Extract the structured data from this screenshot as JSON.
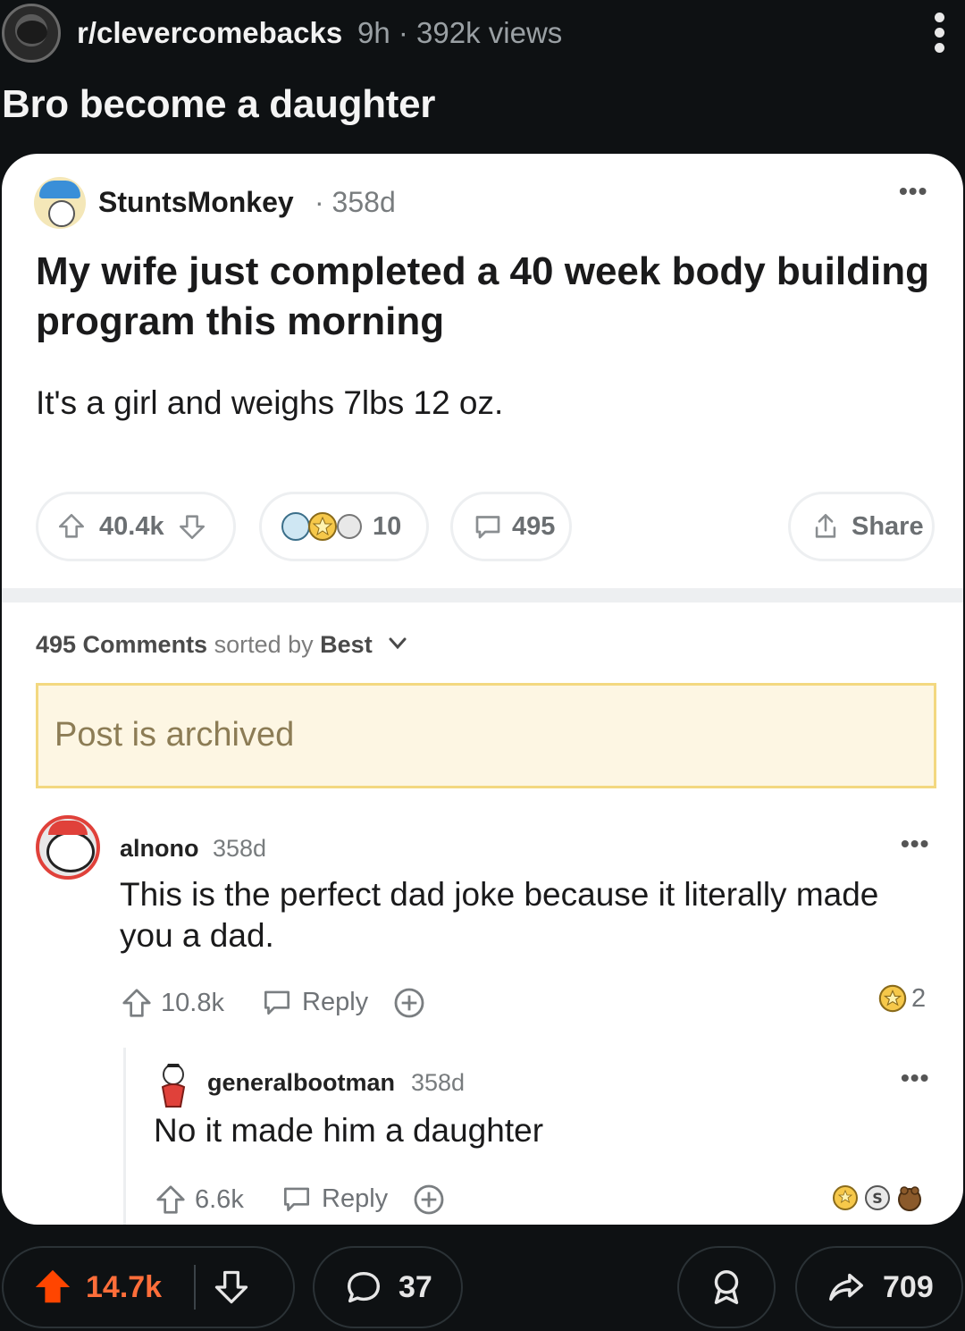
{
  "header": {
    "subreddit": "r/clevercomebacks",
    "meta": "9h · 392k views",
    "title": "Bro become a daughter"
  },
  "post": {
    "author": "StuntsMonkey",
    "time": "· 358d",
    "title": "My wife just completed a 40 week body building program this morning",
    "body": "It's a girl and weighs 7lbs 12 oz.",
    "votes": "40.4k",
    "awards": "10",
    "comments": "495",
    "share_label": "Share"
  },
  "sort": {
    "count_label": "495 Comments",
    "sorted_by": "sorted by",
    "sort_value": "Best"
  },
  "archived_notice": "Post is archived",
  "comments": [
    {
      "author": "alnono",
      "time": "358d",
      "text": "This is the perfect dad joke because it literally made you a dad.",
      "votes": "10.8k",
      "reply_label": "Reply",
      "award_count": "2"
    },
    {
      "author": "generalbootman",
      "time": "358d",
      "text": "No it made him a daughter",
      "votes": "6.6k",
      "reply_label": "Reply"
    }
  ],
  "bottom_bar": {
    "upvotes": "14.7k",
    "comments": "37",
    "shares": "709"
  },
  "colors": {
    "background": "#0e1113",
    "upvote_orange": "#ff4500",
    "archived_bg": "#fdf6e3",
    "archived_border": "#f3d880"
  },
  "icons": [
    "subreddit-avatar-icon",
    "kebab-menu-icon",
    "upvote-icon",
    "downvote-icon",
    "award-icon",
    "comment-icon",
    "share-icon",
    "chevron-down-icon",
    "add-award-icon",
    "share-arrow-icon"
  ]
}
